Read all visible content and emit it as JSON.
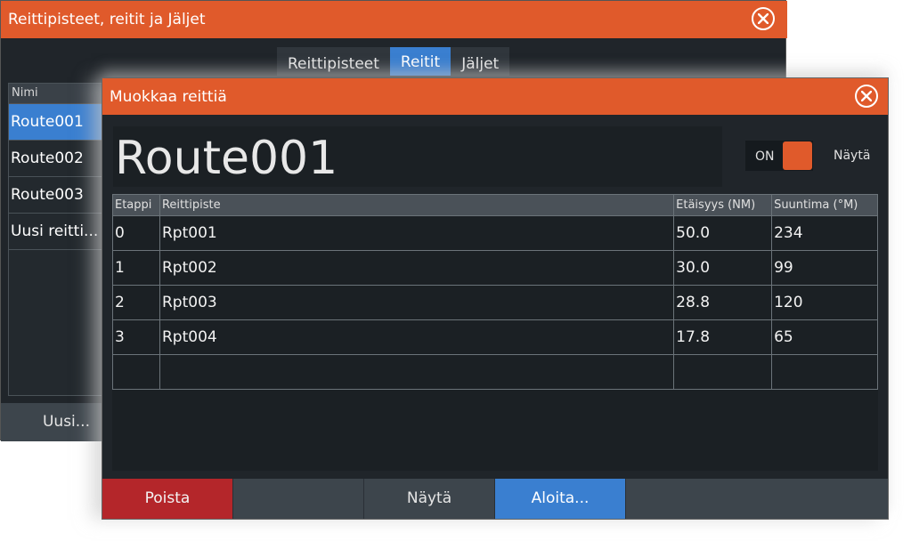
{
  "background_window": {
    "title": "Reittipisteet, reitit ja Jäljet",
    "tabs": [
      {
        "label": "Reittipisteet",
        "active": false
      },
      {
        "label": "Reitit",
        "active": true
      },
      {
        "label": "Jäljet",
        "active": false
      }
    ],
    "list_header": "Nimi",
    "items": [
      {
        "label": "Route001",
        "selected": true
      },
      {
        "label": "Route002",
        "selected": false
      },
      {
        "label": "Route003",
        "selected": false
      },
      {
        "label": "Uusi reitti...",
        "selected": false
      }
    ],
    "new_button": "Uusi..."
  },
  "dialog": {
    "title": "Muokkaa reittiä",
    "route_name": "Route001",
    "toggle": {
      "label": "ON",
      "state": true
    },
    "show_label": "Näytä",
    "table": {
      "columns": [
        "Etappi",
        "Reittipiste",
        "Etäisyys (NM)",
        "Suuntima (°M)"
      ],
      "rows": [
        [
          "0",
          "Rpt001",
          "50.0",
          "234"
        ],
        [
          "1",
          "Rpt002",
          "30.0",
          "99"
        ],
        [
          "2",
          "Rpt003",
          "28.8",
          "120"
        ],
        [
          "3",
          "Rpt004",
          "17.8",
          "65"
        ],
        [
          "",
          "",
          "",
          ""
        ]
      ]
    },
    "buttons": {
      "delete": "Poista",
      "empty": "",
      "show": "Näytä",
      "start": "Aloita..."
    }
  },
  "colors": {
    "accent_orange": "#e05a2b",
    "selection_blue": "#3a7fd0",
    "delete_red": "#b4262a",
    "panel_dark": "#20252a"
  },
  "icons": {
    "close": "close-circle-icon"
  }
}
